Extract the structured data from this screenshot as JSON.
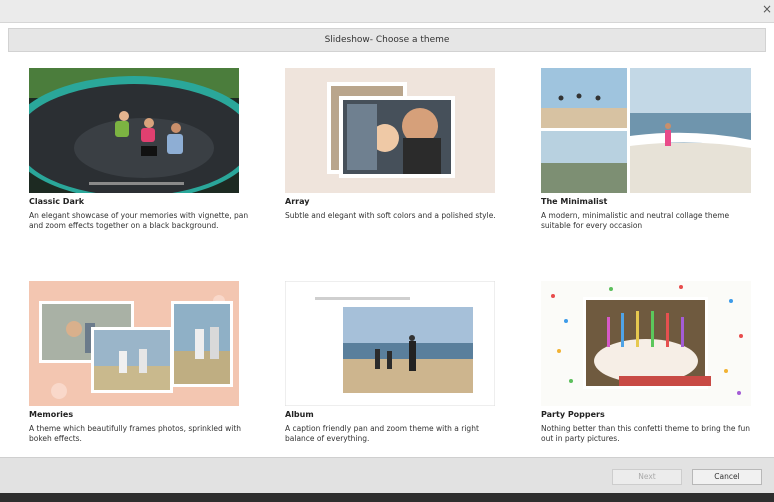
{
  "window": {
    "title": "Slideshow- Choose a theme",
    "close_glyph": "×"
  },
  "themes": [
    {
      "name": "Classic Dark",
      "description": "An elegant showcase of your memories with vignette, pan and zoom effects together on a black background."
    },
    {
      "name": "Array",
      "description": "Subtle and elegant with soft colors and a polished style."
    },
    {
      "name": "The Minimalist",
      "description": "A modern, minimalistic and neutral collage theme suitable for every occasion"
    },
    {
      "name": "Memories",
      "description": "A theme which beautifully frames photos, sprinkled with bokeh effects."
    },
    {
      "name": "Album",
      "description": "A caption friendly pan and zoom theme with a right balance of everything."
    },
    {
      "name": "Party Poppers",
      "description": "Nothing better than this confetti theme to bring the fun out in party pictures."
    }
  ],
  "buttons": {
    "next_label": "Next",
    "cancel_label": "Cancel"
  },
  "colors": {
    "accent_red": "#c84a45",
    "trampoline_teal": "#2aa79a",
    "memories_peach": "#f3c6b1"
  },
  "icons": {
    "close": "close-icon"
  }
}
